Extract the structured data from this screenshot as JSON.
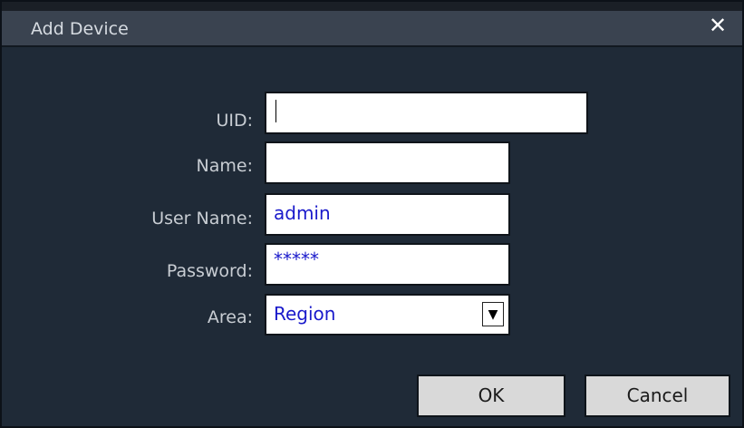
{
  "dialog": {
    "title": "Add Device",
    "close_icon": "close-icon",
    "uid_label": "UID:",
    "uid_value": "",
    "name_label": "Name:",
    "name_value": "",
    "username_label": "User Name:",
    "username_value": "admin",
    "password_label": "Password:",
    "password_value": "*****",
    "area_label": "Area:",
    "area_value": "Region",
    "ok_label": "OK",
    "cancel_label": "Cancel"
  }
}
